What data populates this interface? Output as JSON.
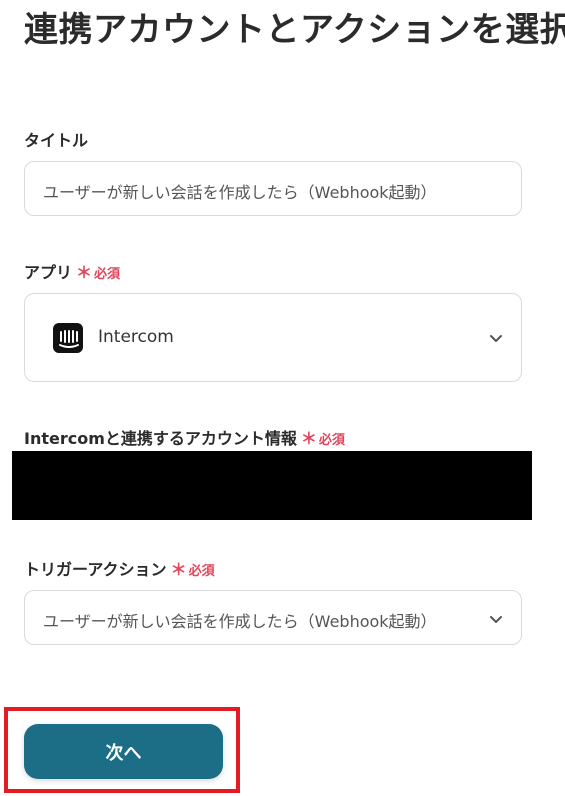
{
  "page": {
    "title": "連携アカウントとアクションを選択"
  },
  "fields": {
    "title": {
      "label": "タイトル",
      "value": "ユーザーが新しい会話を作成したら（Webhook起動）"
    },
    "app": {
      "label": "アプリ",
      "required_label": "必須",
      "required_mark": "＊",
      "value": "Intercom",
      "icon": "intercom-logo-icon"
    },
    "account": {
      "label": "Intercomと連携するアカウント情報",
      "required_label": "必須",
      "required_mark": "＊"
    },
    "trigger": {
      "label": "トリガーアクション",
      "required_label": "必須",
      "required_mark": "＊",
      "value": "ユーザーが新しい会話を作成したら（Webhook起動）"
    }
  },
  "actions": {
    "next_label": "次へ"
  },
  "colors": {
    "required": "#e0455b",
    "primary_button": "#1b6e86",
    "highlight": "#e31b23"
  }
}
